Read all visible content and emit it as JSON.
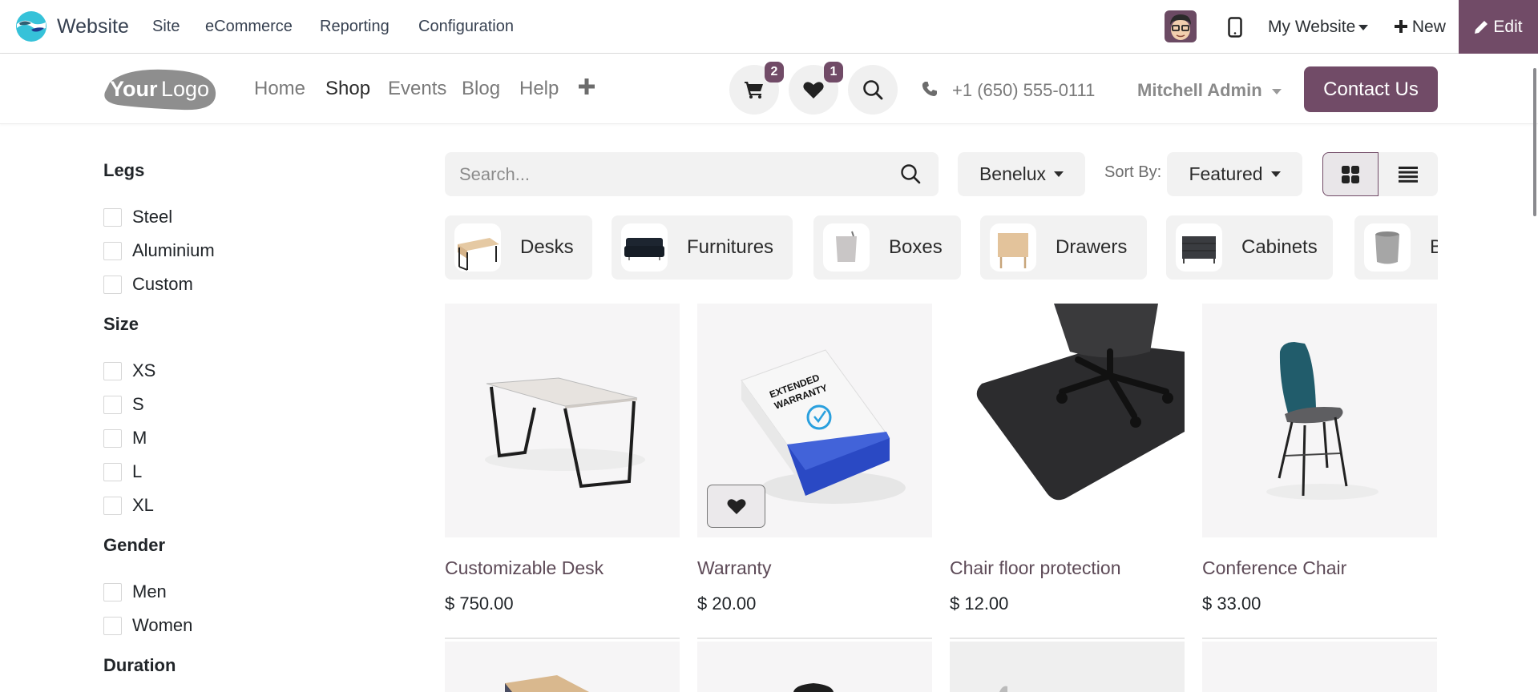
{
  "topbar": {
    "app_name": "Website",
    "menu": [
      "Site",
      "eCommerce",
      "Reporting",
      "Configuration"
    ],
    "website_selector": "My Website",
    "new_label": "New",
    "edit_label": "Edit",
    "icons": {
      "app_logo": "odoo-website-icon",
      "avatar": "user-avatar",
      "mobile": "mobile-preview-icon",
      "new": "plus-icon",
      "edit": "pencil-icon"
    }
  },
  "site_header": {
    "logo_text_bold": "Your",
    "logo_text_light": "Logo",
    "nav": [
      {
        "label": "Home",
        "active": false
      },
      {
        "label": "Shop",
        "active": true
      },
      {
        "label": "Events",
        "active": false
      },
      {
        "label": "Blog",
        "active": false
      },
      {
        "label": "Help",
        "active": false
      }
    ],
    "cart_count": "2",
    "wishlist_count": "1",
    "phone": "+1 (650) 555-0111",
    "user": "Mitchell Admin",
    "contact_label": "Contact Us",
    "accent_color": "#714b67"
  },
  "filters": [
    {
      "title": "Legs",
      "options": [
        "Steel",
        "Aluminium",
        "Custom"
      ]
    },
    {
      "title": "Size",
      "options": [
        "XS",
        "S",
        "M",
        "L",
        "XL"
      ]
    },
    {
      "title": "Gender",
      "options": [
        "Men",
        "Women"
      ]
    },
    {
      "title": "Duration",
      "options": []
    }
  ],
  "toolbar": {
    "search_placeholder": "Search...",
    "search_value": "",
    "pricelist": "Benelux",
    "sort_label": "Sort By:",
    "sort_value": "Featured",
    "view_mode": "grid"
  },
  "categories": [
    "Desks",
    "Furnitures",
    "Boxes",
    "Drawers",
    "Cabinets",
    "Bins"
  ],
  "products": [
    {
      "name": "Customizable Desk",
      "price": "$ 750.00"
    },
    {
      "name": "Warranty",
      "price": "$ 20.00",
      "image_text": [
        "EXTENDED",
        "WARRANTY"
      ]
    },
    {
      "name": "Chair floor protection",
      "price": "$ 12.00"
    },
    {
      "name": "Conference Chair",
      "price": "$ 33.00"
    }
  ]
}
